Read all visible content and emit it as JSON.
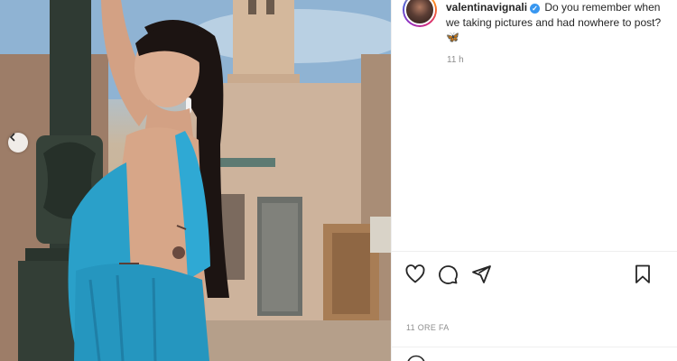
{
  "post": {
    "username": "valentinavignali",
    "verified": true,
    "caption": "Do you remember when we taking pictures and had nowhere to post? 🦋",
    "caption_time": "11 h",
    "post_time": "11 ORE FA"
  },
  "icons": {
    "carousel_prev": "chevron-left-icon",
    "like": "heart-icon",
    "comment": "comment-icon",
    "share": "paper-plane-icon",
    "save": "bookmark-icon",
    "emoji": "smiley-icon"
  },
  "colors": {
    "accent": "#3897f0",
    "muted_text": "#8e8e8e",
    "dress": "#2aa0c9"
  }
}
